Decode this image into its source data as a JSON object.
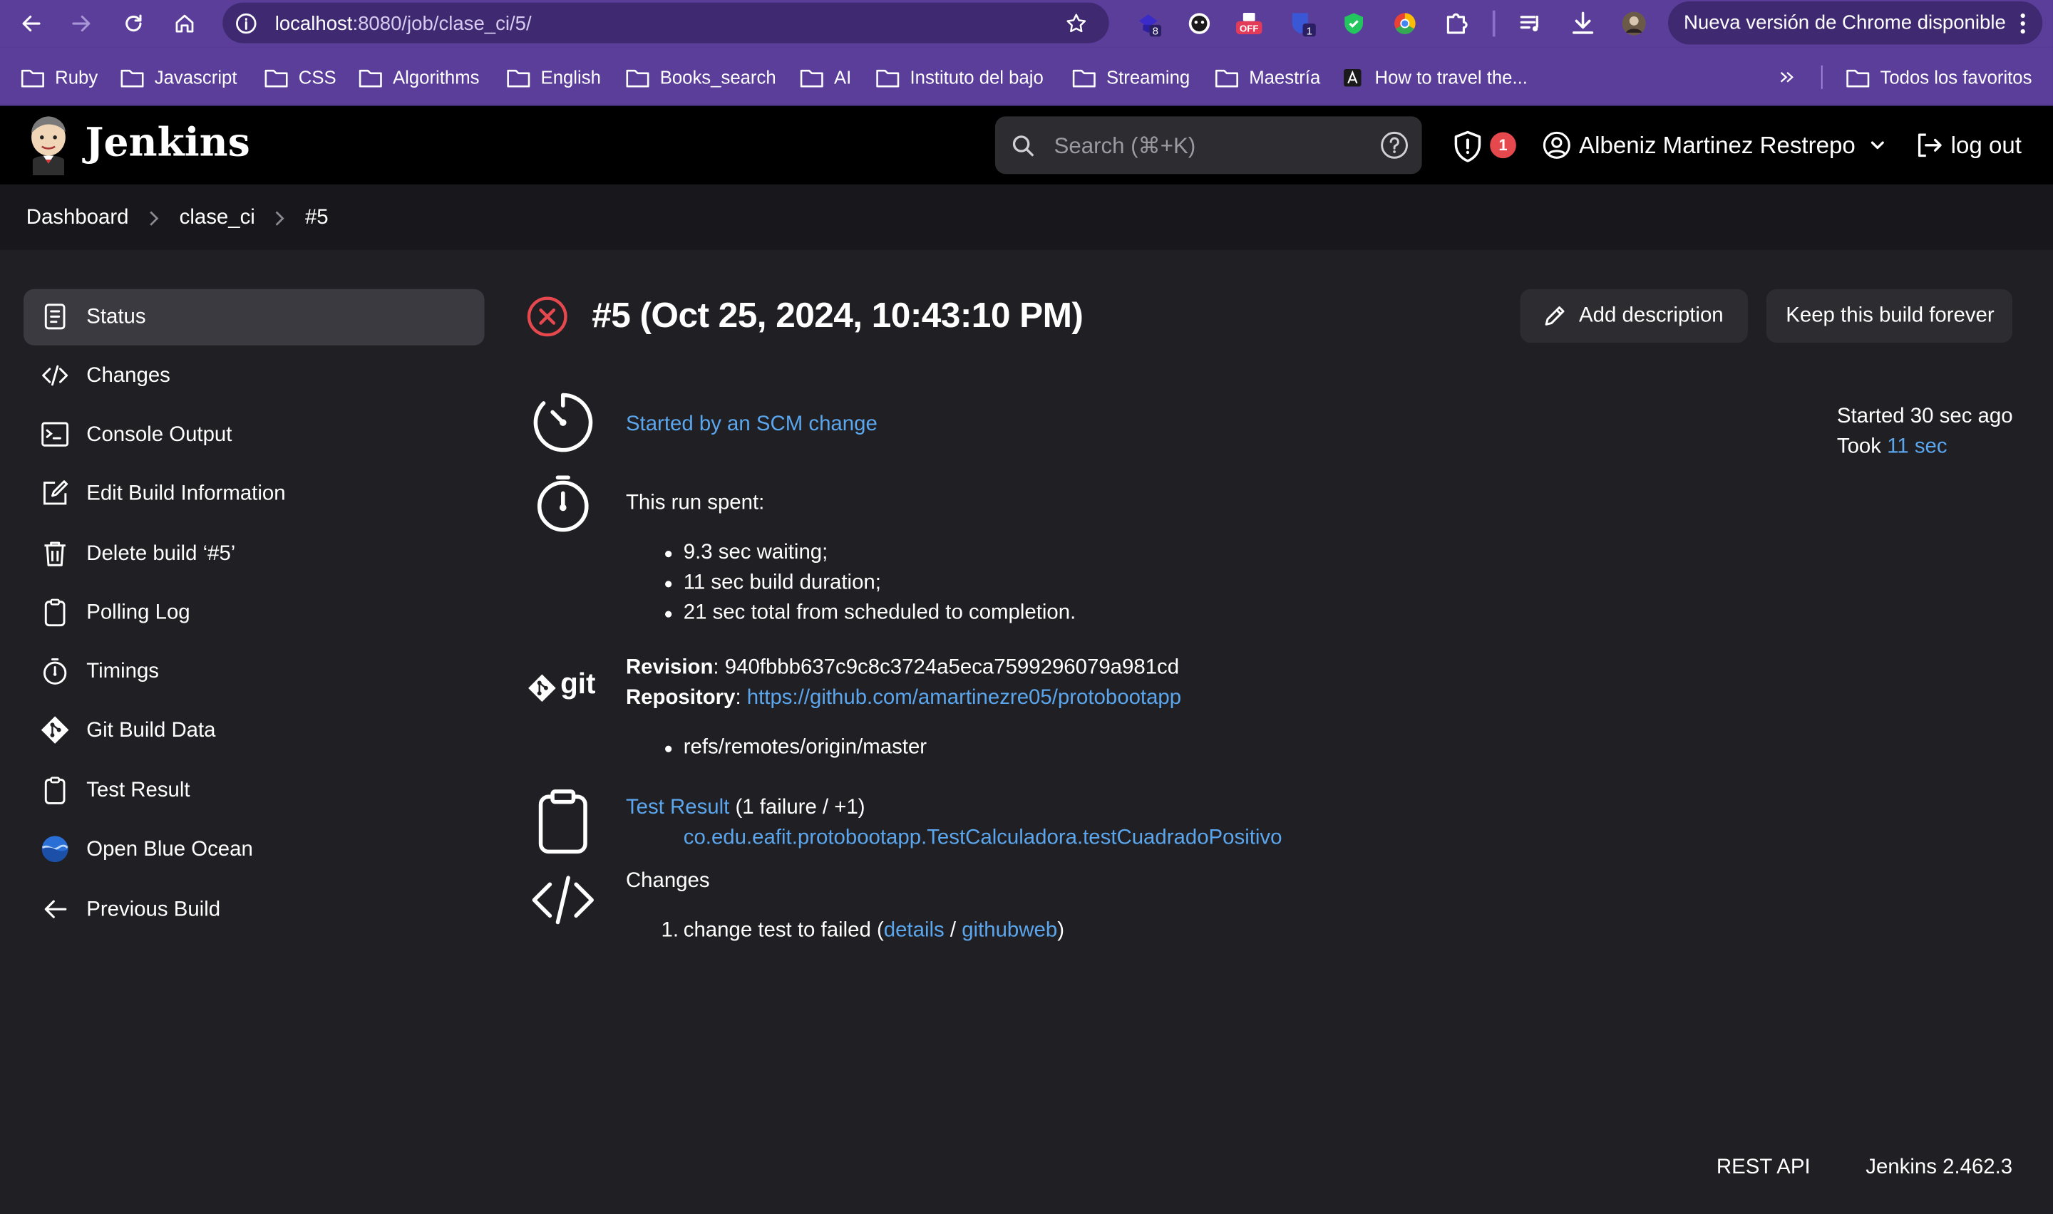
{
  "browser": {
    "url_host": "localhost",
    "url_rest": ":8080/job/clase_ci/5/",
    "update_label": "Nueva versión de Chrome disponible",
    "extensions": [
      {
        "name": "extension-badge-8",
        "badge": "8"
      },
      {
        "name": "extension-face"
      },
      {
        "name": "extension-off",
        "badge": "OFF"
      },
      {
        "name": "extension-shield-1",
        "badge": "1"
      },
      {
        "name": "extension-green-shield"
      },
      {
        "name": "extension-chrome-circle"
      },
      {
        "name": "extensions-puzzle"
      }
    ],
    "bookmarks": [
      "Ruby",
      "Javascript",
      "CSS",
      "Algorithms",
      "English",
      "Books_search",
      "AI",
      "Instituto del bajo",
      "Streaming",
      "Maestría",
      "How to travel the..."
    ],
    "all_bookmarks_label": "Todos los favoritos"
  },
  "jenkins": {
    "title": "Jenkins",
    "search_placeholder": "Search (⌘+K)",
    "alert_count": "1",
    "user_name": "Albeniz Martinez Restrepo",
    "logout_label": "log out"
  },
  "breadcrumb": [
    "Dashboard",
    "clase_ci",
    "#5"
  ],
  "sidebar": {
    "items": [
      {
        "label": "Status",
        "icon": "document-icon"
      },
      {
        "label": "Changes",
        "icon": "code-icon"
      },
      {
        "label": "Console Output",
        "icon": "terminal-icon"
      },
      {
        "label": "Edit Build Information",
        "icon": "edit-icon"
      },
      {
        "label": "Delete build ‘#5’",
        "icon": "trash-icon"
      },
      {
        "label": "Polling Log",
        "icon": "clipboard-icon"
      },
      {
        "label": "Timings",
        "icon": "stopwatch-icon"
      },
      {
        "label": "Git Build Data",
        "icon": "git-icon"
      },
      {
        "label": "Test Result",
        "icon": "clipboard-icon"
      },
      {
        "label": "Open Blue Ocean",
        "icon": "blue-ocean-icon"
      },
      {
        "label": "Previous Build",
        "icon": "arrow-left-icon"
      }
    ]
  },
  "build": {
    "title": "#5 (Oct 25, 2024, 10:43:10 PM)",
    "status_color": "#e5484d",
    "add_description_label": "Add description",
    "keep_forever_label": "Keep this build forever",
    "started_by": "Started by an SCM change",
    "started_ago": "Started 30 sec ago",
    "took_label": "Took",
    "took_value": "11 sec",
    "run_spent_label": "This run spent:",
    "run_spent_items": [
      "9.3 sec waiting;",
      "11 sec build duration;",
      "21 sec total from scheduled to completion."
    ],
    "git_logo_text": "git",
    "revision_label": "Revision",
    "revision_value": ": 940fbbb637c9c8c3724a5eca7599296079a981cd",
    "repository_label": "Repository",
    "repository_sep": ": ",
    "repository_url": "https://github.com/amartinezre05/protobootapp",
    "refs": [
      "refs/remotes/origin/master"
    ],
    "test_result_label": "Test Result",
    "test_result_summary": " (1 failure / +1)",
    "failed_test": "co.edu.eafit.protobootapp.TestCalculadora.testCuadradoPositivo",
    "changes_label": "Changes",
    "change_number": "1.",
    "change_text": "change test to failed (",
    "change_details": "details",
    "change_sep": " / ",
    "change_githubweb": "githubweb",
    "change_close": ")"
  },
  "footer": {
    "rest_api": "REST API",
    "version": "Jenkins 2.462.3"
  },
  "colors": {
    "link": "#5ba6ec",
    "chrome_purple": "#5b3e9a",
    "background": "#1f1f24"
  }
}
